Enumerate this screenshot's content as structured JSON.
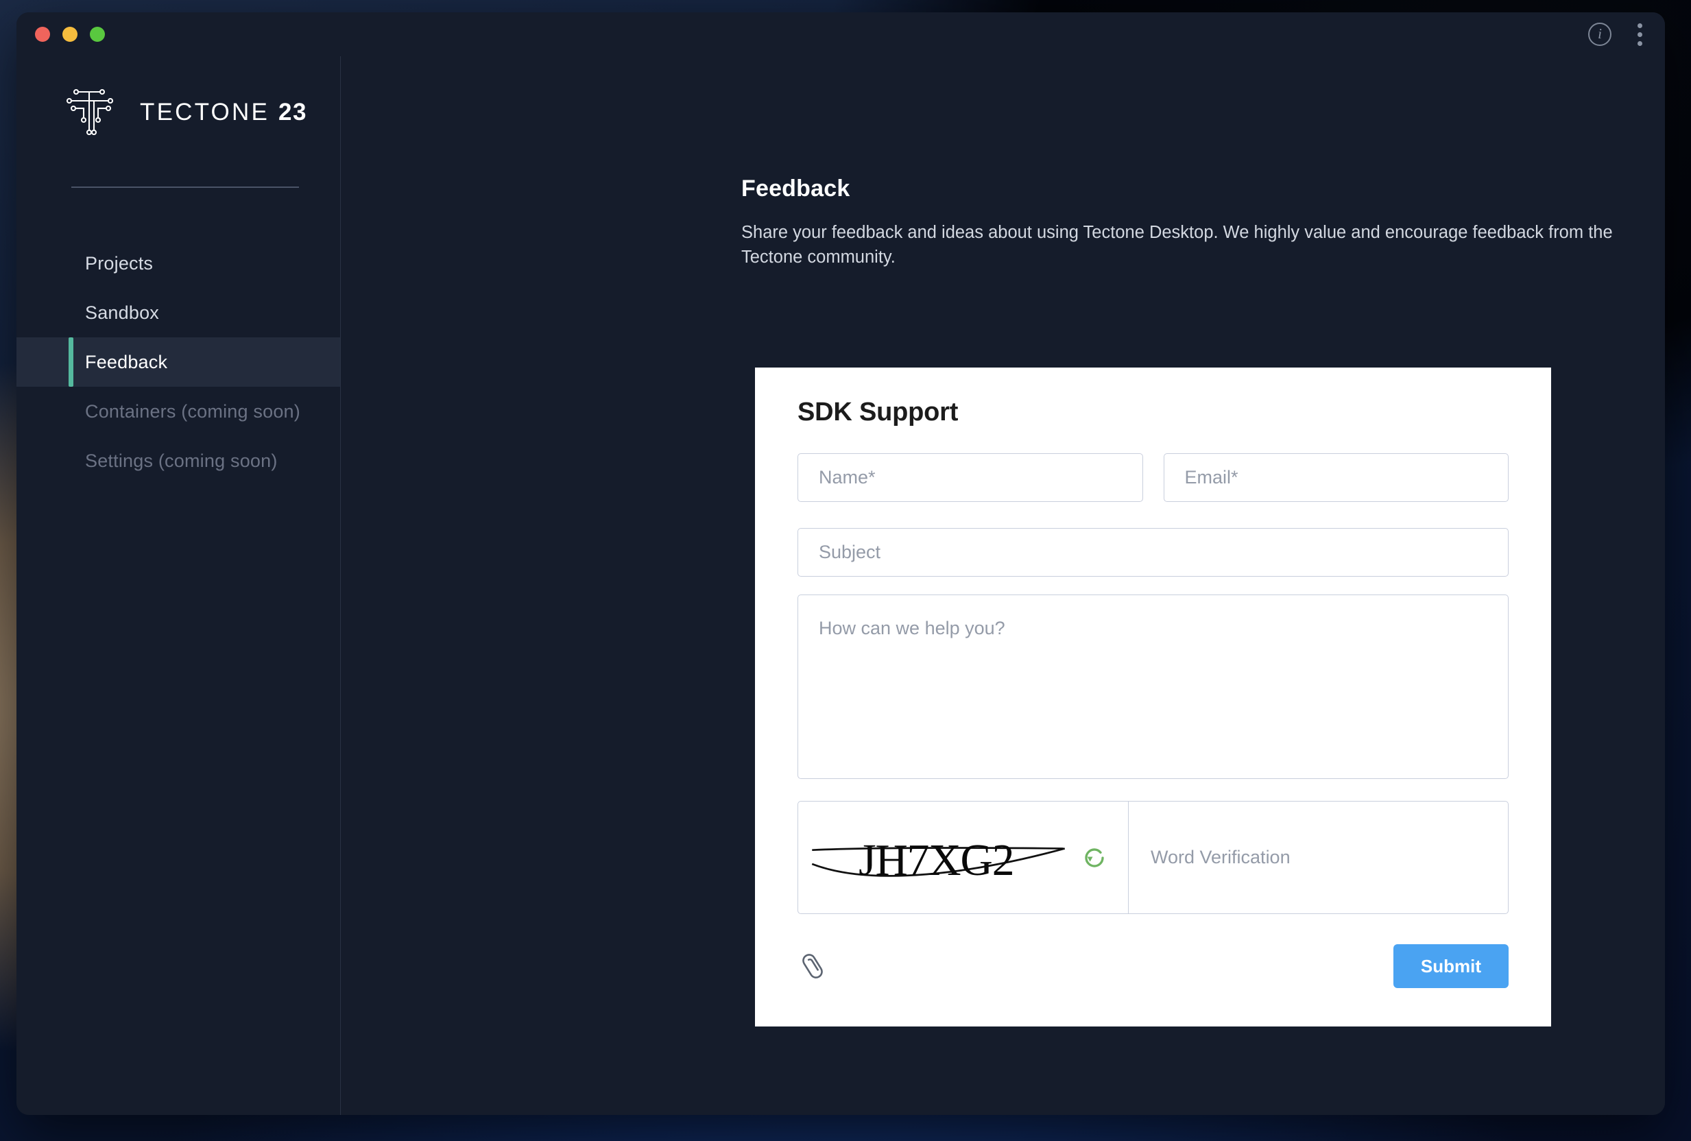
{
  "window": {
    "traffic_lights": [
      "close",
      "minimize",
      "maximize"
    ],
    "info_icon_glyph": "i",
    "info_icon_name": "info-icon",
    "menu_icon_name": "kebab-menu-icon"
  },
  "sidebar": {
    "brand": {
      "name": "TECTONE",
      "suffix": "23",
      "logo_icon": "tectone-circuit-logo"
    },
    "items": [
      {
        "label": "Projects",
        "state": "normal",
        "name": "projects"
      },
      {
        "label": "Sandbox",
        "state": "normal",
        "name": "sandbox"
      },
      {
        "label": "Feedback",
        "state": "active",
        "name": "feedback"
      },
      {
        "label": "Containers (coming soon)",
        "state": "disabled",
        "name": "containers"
      },
      {
        "label": "Settings (coming soon)",
        "state": "disabled",
        "name": "settings"
      }
    ]
  },
  "main": {
    "title": "Feedback",
    "description": "Share your feedback and ideas about using Tectone Desktop. We highly value and encourage feedback from the Tectone community."
  },
  "form": {
    "card_title": "SDK Support",
    "name_placeholder": "Name*",
    "email_placeholder": "Email*",
    "subject_placeholder": "Subject",
    "message_placeholder": "How can we help you?",
    "captcha_text": "JH7XG2",
    "captcha_refresh_name": "refresh-captcha-icon",
    "word_verification_placeholder": "Word Verification",
    "attach_icon_name": "paperclip-attach-icon",
    "submit_label": "Submit"
  },
  "colors": {
    "window_bg": "#151c2b",
    "sidebar_active_bg": "#232b3c",
    "accent_teal": "#55b99e",
    "submit_blue": "#4aa3f2",
    "refresh_green": "#6fb462",
    "card_white": "#ffffff",
    "field_border": "#c9cfdd",
    "placeholder_text": "#949ba8"
  }
}
